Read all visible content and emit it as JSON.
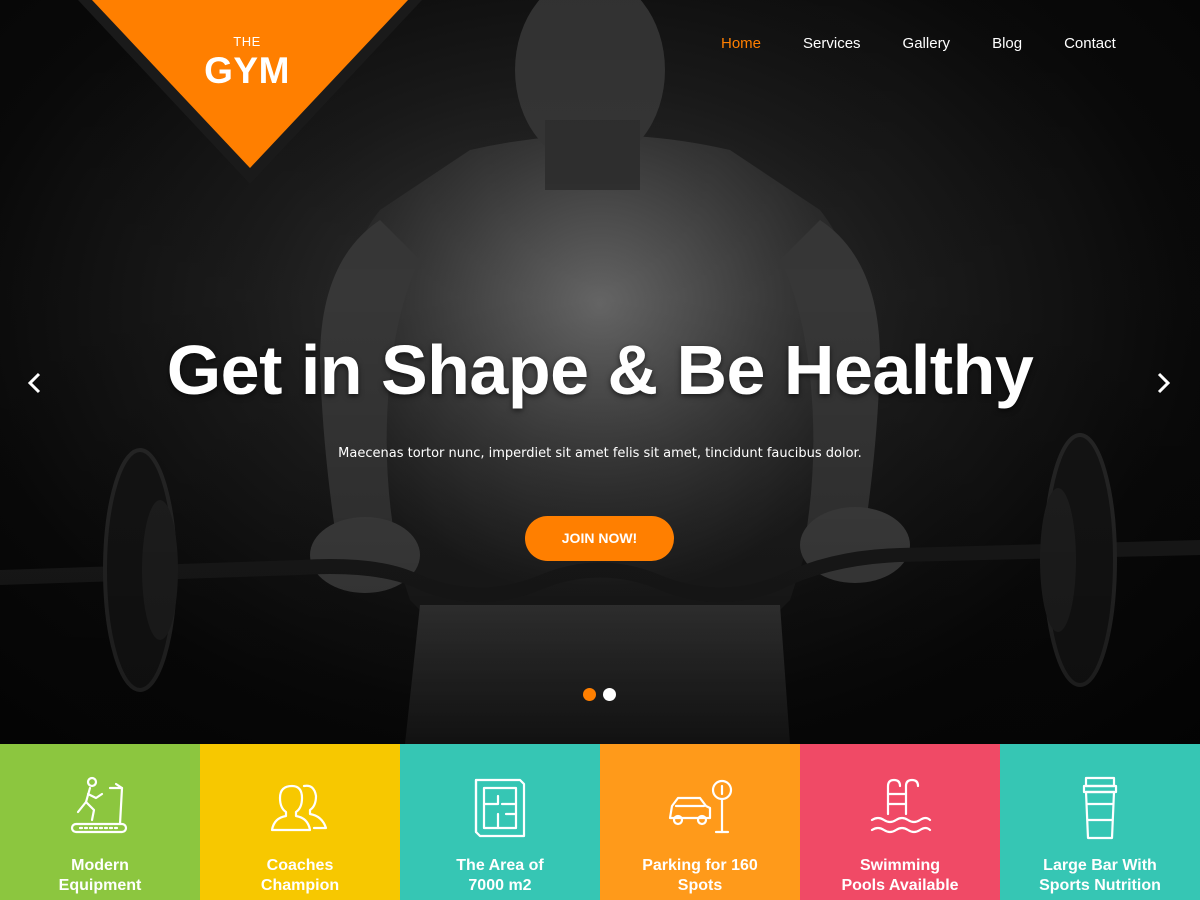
{
  "logo": {
    "top_text": "THE",
    "main_text": "GYM"
  },
  "nav": {
    "items": [
      {
        "label": "Home",
        "active": true
      },
      {
        "label": "Services",
        "active": false
      },
      {
        "label": "Gallery",
        "active": false
      },
      {
        "label": "Blog",
        "active": false
      },
      {
        "label": "Contact",
        "active": false
      }
    ]
  },
  "hero": {
    "title": "Get in Shape & Be Healthy",
    "subtitle": "Maecenas tortor nunc, imperdiet sit amet felis sit amet, tincidunt faucibus dolor.",
    "cta_label": "JOIN NOW!",
    "slide_count": 2,
    "active_slide": 1
  },
  "features": [
    {
      "label": "Modern\nEquipment",
      "color": "#8cc63f",
      "icon": "treadmill-icon"
    },
    {
      "label": "Coaches\nChampion",
      "color": "#f7c800",
      "icon": "users-icon"
    },
    {
      "label": "The Area of\n7000 m2",
      "color": "#36c6b4",
      "icon": "floor-plan-icon"
    },
    {
      "label": "Parking for 160\nSpots",
      "color": "#ff9a1a",
      "icon": "parking-car-icon"
    },
    {
      "label": "Swimming\nPools Available",
      "color": "#f04a66",
      "icon": "pool-ladder-icon"
    },
    {
      "label": "Large Bar With\nSports Nutrition",
      "color": "#36c6b4",
      "icon": "drink-cup-icon"
    }
  ],
  "colors": {
    "accent": "#ff7f00",
    "logo_bg": "#ff7f00",
    "logo_border": "#1a1a1a"
  }
}
